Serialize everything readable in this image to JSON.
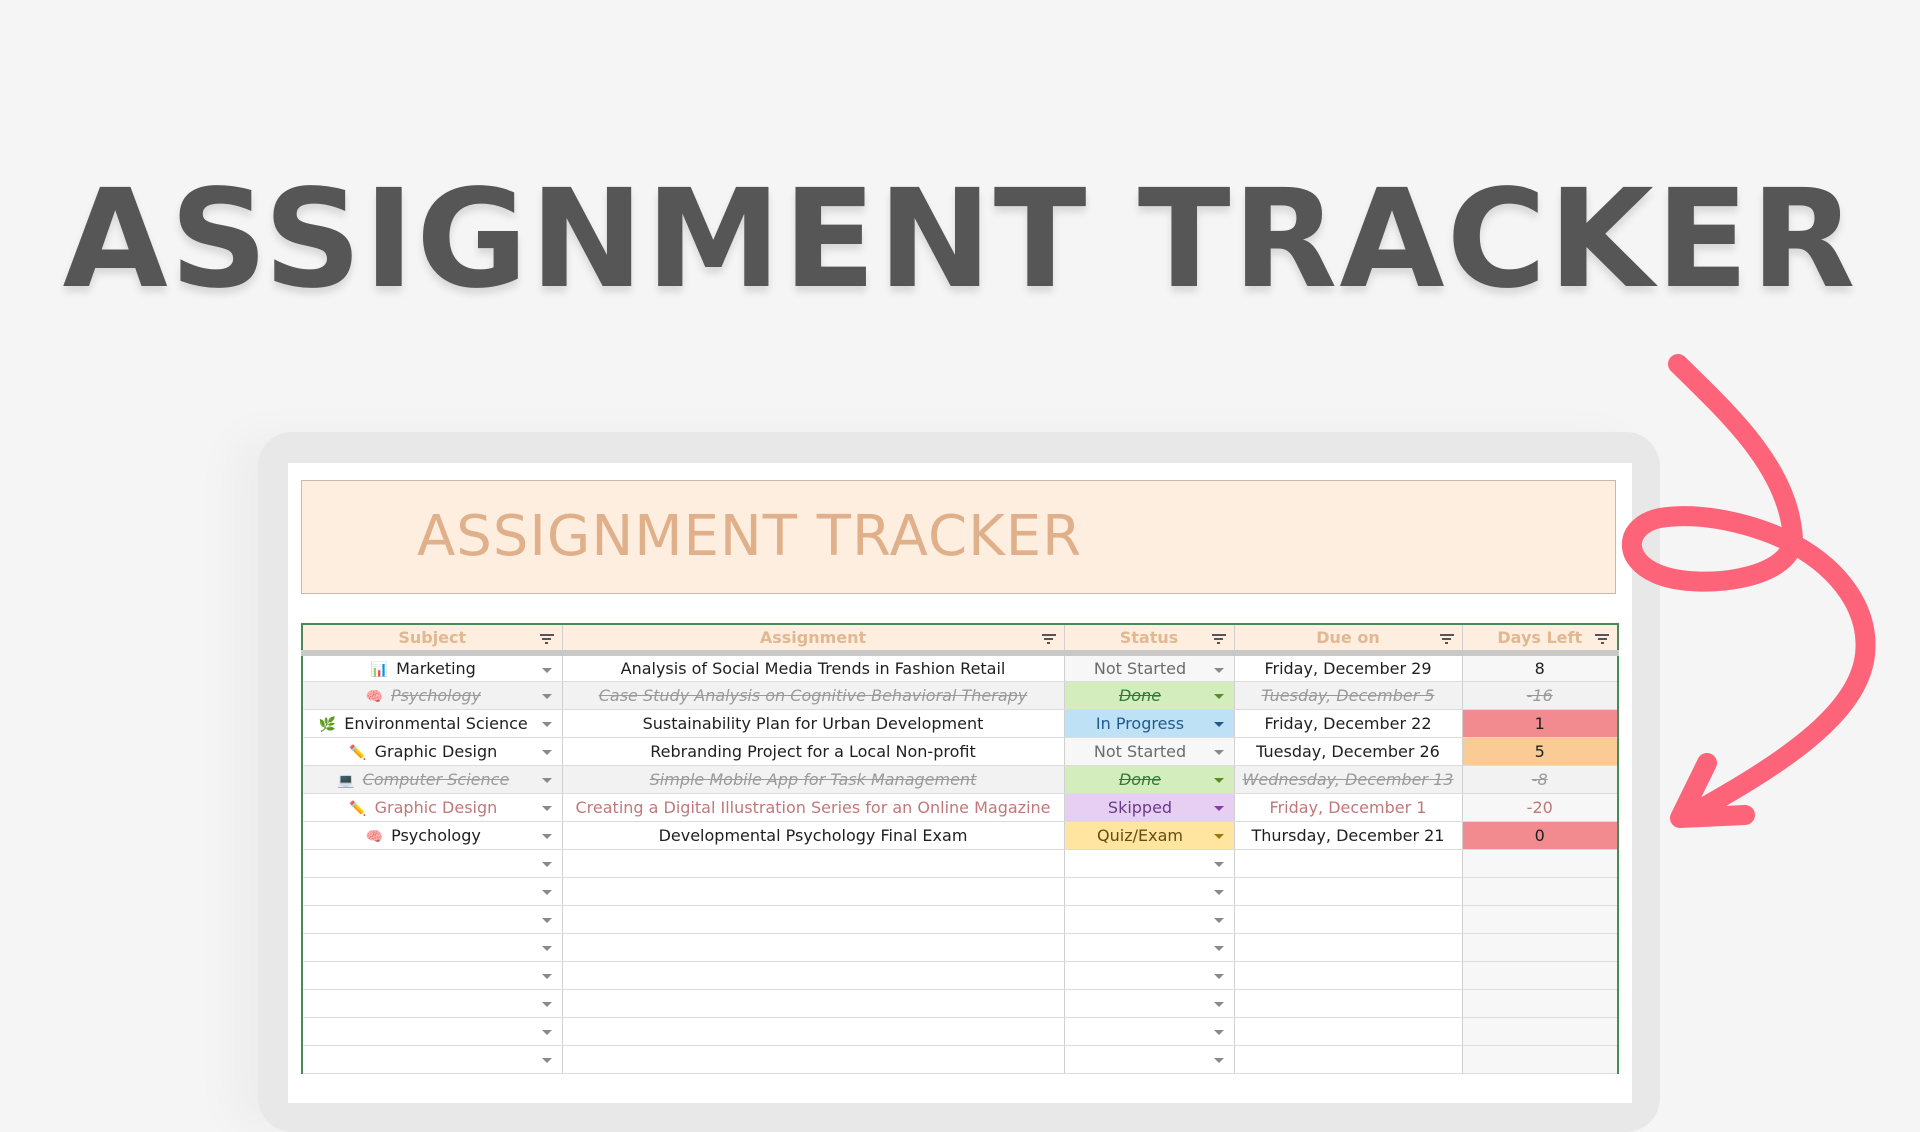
{
  "hero": {
    "title": "ASSIGNMENT TRACKER"
  },
  "sheet": {
    "banner_title": "ASSIGNMENT TRACKER",
    "columns": [
      "Subject",
      "Assignment",
      "Status",
      "Due on",
      "Days Left"
    ],
    "rows": [
      {
        "icon": "📊",
        "icon_name": "bar-chart-icon",
        "subject": "Marketing",
        "assignment": "Analysis of Social Media Trends in Fashion Retail",
        "status": "Not Started",
        "due": "Friday, December 29",
        "days_left": "8",
        "style": "normal"
      },
      {
        "icon": "🧠",
        "icon_name": "brain-icon",
        "subject": "Psychology",
        "assignment": "Case Study Analysis on Cognitive Behavioral Therapy",
        "status": "Done",
        "due": "Tuesday, December 5",
        "days_left": "-16",
        "style": "done"
      },
      {
        "icon": "🌿",
        "icon_name": "herb-icon",
        "subject": "Environmental Science",
        "assignment": "Sustainability Plan for Urban Development",
        "status": "In Progress",
        "due": "Friday, December 22",
        "days_left": "1",
        "style": "normal"
      },
      {
        "icon": "✏️",
        "icon_name": "pencil-icon",
        "subject": "Graphic Design",
        "assignment": "Rebranding Project for a Local Non-profit",
        "status": "Not Started",
        "due": "Tuesday, December 26",
        "days_left": "5",
        "style": "normal"
      },
      {
        "icon": "💻",
        "icon_name": "laptop-icon",
        "subject": "Computer Science",
        "assignment": "Simple Mobile App for Task Management",
        "status": "Done",
        "due": "Wednesday, December 13",
        "days_left": "-8",
        "style": "done"
      },
      {
        "icon": "✏️",
        "icon_name": "pencil-icon",
        "subject": "Graphic Design",
        "assignment": "Creating a Digital Illustration Series for an Online Magazine",
        "status": "Skipped",
        "due": "Friday, December 1",
        "days_left": "-20",
        "style": "skipped"
      },
      {
        "icon": "🧠",
        "icon_name": "brain-icon",
        "subject": "Psychology",
        "assignment": "Developmental Psychology Final Exam",
        "status": "Quiz/Exam",
        "due": "Thursday, December 21",
        "days_left": "0",
        "style": "normal"
      }
    ],
    "empty_rows": 8
  },
  "colors": {
    "status": {
      "Not Started": {
        "bg": "#f7f7f7",
        "fg": "#6b6b6b",
        "caret": "#8a8a8a"
      },
      "Done": {
        "bg": "#d4edbc",
        "fg": "#2f7a3a",
        "caret": "#5a8a2a"
      },
      "In Progress": {
        "bg": "#bfe1f6",
        "fg": "#1f5a8a",
        "caret": "#1f5a8a"
      },
      "Skipped": {
        "bg": "#e6cff2",
        "fg": "#6a3a8a",
        "caret": "#8a3aa8"
      },
      "Quiz/Exam": {
        "bg": "#ffe5a0",
        "fg": "#6a4a10",
        "caret": "#9a7a10"
      }
    },
    "days_urgent": "#f28b8f",
    "days_soon": "#fbcb96",
    "arrow": "#fd6379"
  }
}
